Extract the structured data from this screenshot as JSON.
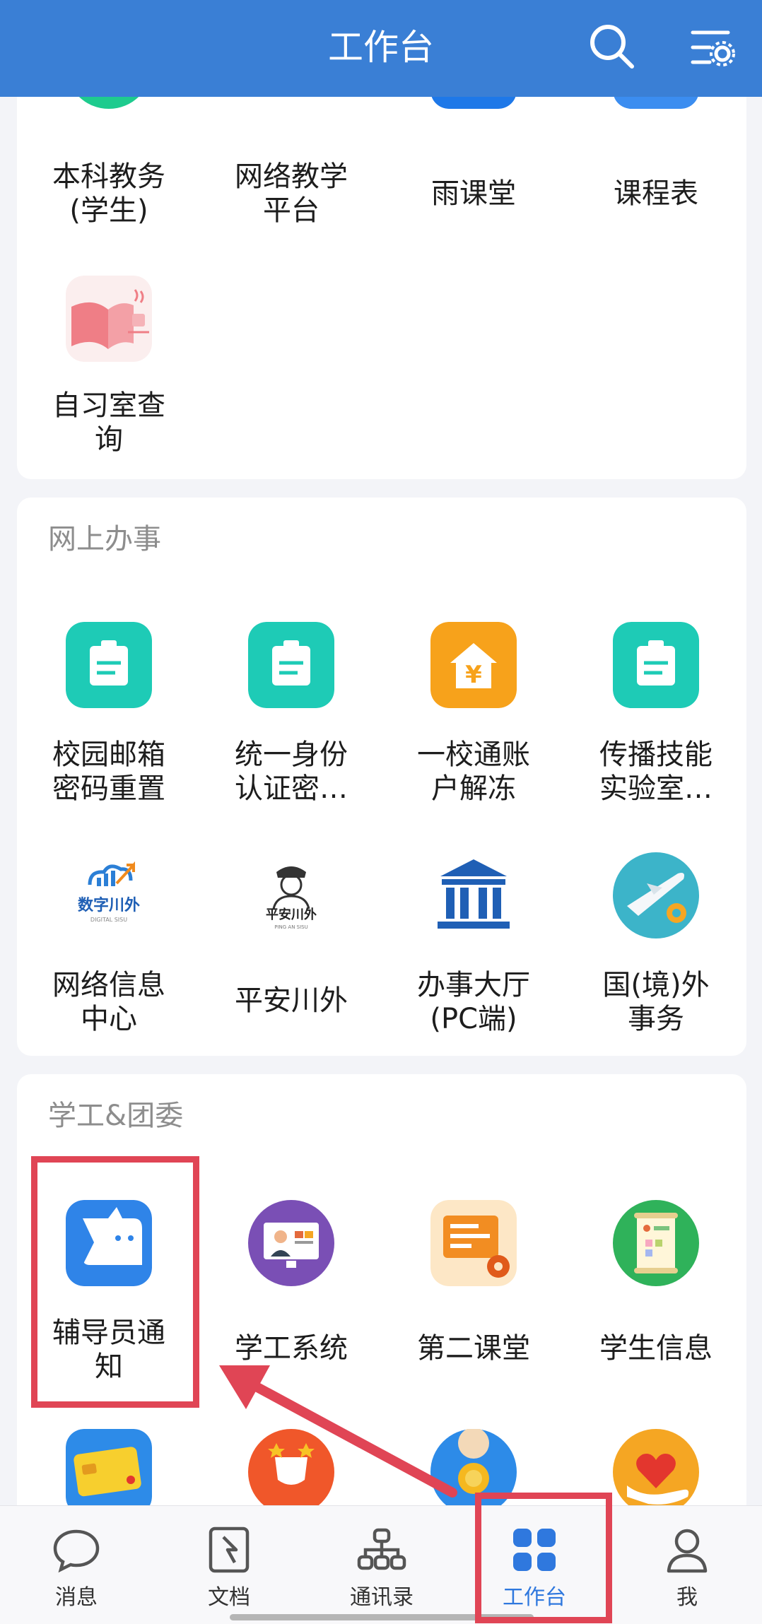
{
  "header": {
    "title": "工作台"
  },
  "section_top": {
    "apps": [
      {
        "label": "本科教务\n(学生)"
      },
      {
        "label": "网络教学\n平台"
      },
      {
        "label": "雨课堂"
      },
      {
        "label": "课程表"
      },
      {
        "label": "自习室查\n询"
      }
    ]
  },
  "section_online": {
    "title": "网上办事",
    "apps": [
      {
        "label": "校园邮箱\n密码重置"
      },
      {
        "label": "统一身份\n认证密…"
      },
      {
        "label": "一校通账\n户解冻"
      },
      {
        "label": "传播技能\n实验室…"
      },
      {
        "label": "网络信息\n中心",
        "icon_text": "数字川外",
        "icon_subtext": "DIGITAL SISU"
      },
      {
        "label": "平安川外",
        "icon_text": "平安川外",
        "icon_subtext": "PING AN SISU"
      },
      {
        "label": "办事大厅\n(PC端)"
      },
      {
        "label": "国(境)外\n事务"
      }
    ]
  },
  "section_student": {
    "title": "学工&团委",
    "apps": [
      {
        "label": "辅导员通\n知"
      },
      {
        "label": "学工系统"
      },
      {
        "label": "第二课堂"
      },
      {
        "label": "学生信息"
      }
    ]
  },
  "bottom_nav": {
    "items": [
      {
        "label": "消息",
        "icon": "chat-bubble-icon"
      },
      {
        "label": "文档",
        "icon": "document-icon"
      },
      {
        "label": "通讯录",
        "icon": "org-chart-icon"
      },
      {
        "label": "工作台",
        "icon": "grid-icon",
        "active": true
      },
      {
        "label": "我",
        "icon": "person-icon"
      }
    ]
  },
  "colors": {
    "header": "#3a7fd5",
    "accent": "#2f78de",
    "highlight": "#e04555",
    "teal": "#1ecbb6"
  }
}
